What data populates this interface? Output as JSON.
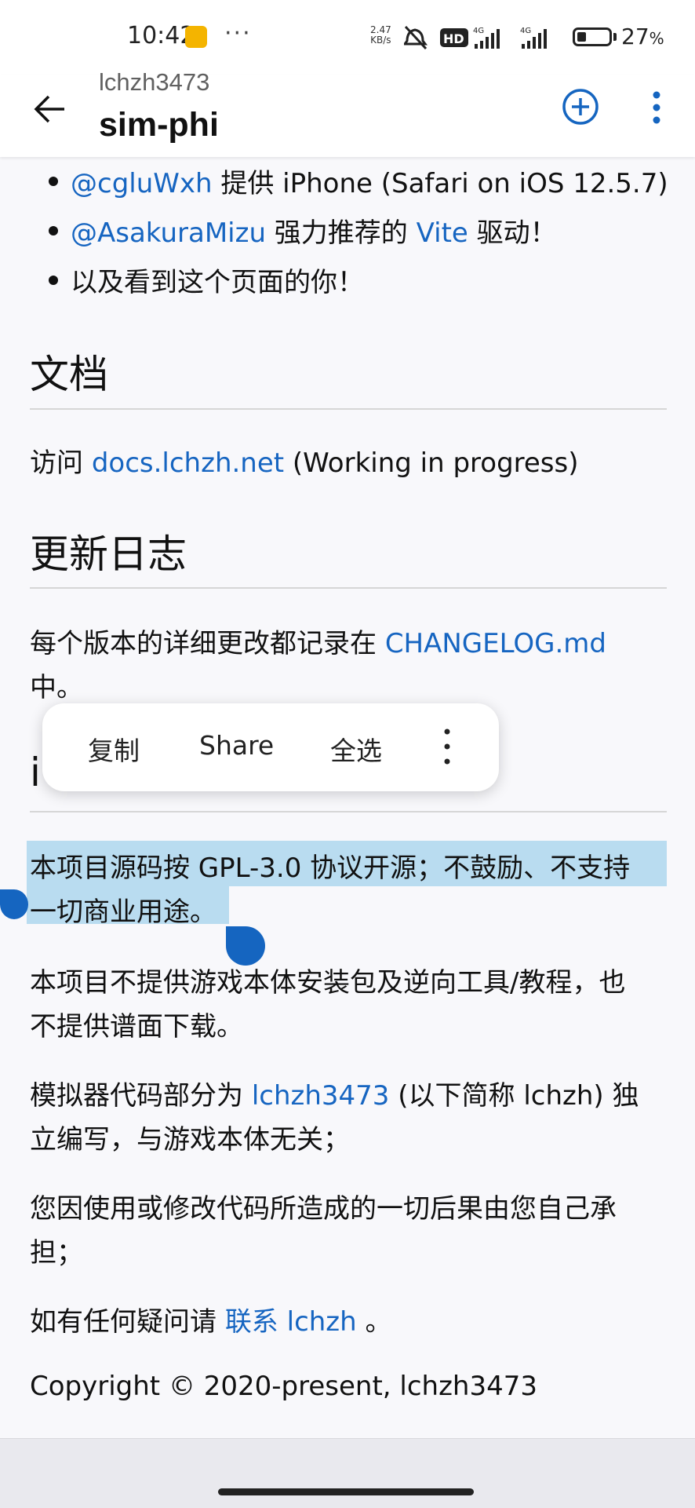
{
  "status_bar": {
    "time": "10:42",
    "dots": "···",
    "net_speed_value": "2.47",
    "net_speed_unit": "KB/s",
    "hd_label": "HD",
    "signal1_label": "4G",
    "signal2_label": "4G",
    "battery_percent": "27",
    "battery_unit": "%"
  },
  "app_bar": {
    "owner": "lchzh3473",
    "repo": "sim-phi"
  },
  "credits": [
    {
      "handle": "@cgluWxh",
      "rest": " 提供 iPhone (Safari on iOS 12.5.7)"
    },
    {
      "handle": "@AsakuraMizu",
      "mid": " 强力推荐的 ",
      "link2": "Vite",
      "rest": " 驱动！"
    },
    {
      "text": "以及看到这个页面的你！"
    }
  ],
  "docs": {
    "heading": "文档",
    "prefix": "访问 ",
    "link": "docs.lchzh.net",
    "suffix": " (Working in progress)"
  },
  "changelog": {
    "heading": "更新日志",
    "prefix": "每个版本的详细更改都记录在 ",
    "link": "CHANGELOG.md",
    "suffix": "中。"
  },
  "license": {
    "heading_partial": "i",
    "p1": "本项目源码按 GPL-3.0 协议开源；不鼓励、不支持一切商业用途。",
    "p1_line1": "本项目源码按 GPL-3.0 协议开源；不鼓励、不支持",
    "p1_line2": "一切商业用途。",
    "p2_line1": "本项目不提供游戏本体安装包及逆向工具/教程，也",
    "p2_line2": "不提供谱面下载。",
    "p3_prefix": "模拟器代码部分为 ",
    "p3_link": "lchzh3473",
    "p3_mid": " (以下简称 lchzh) 独",
    "p3_line2": "立编写，与游戏本体无关；",
    "p4_line1": "您因使用或修改代码所造成的一切后果由您自己承",
    "p4_line2": "担；",
    "p5_prefix": "如有任何疑问请 ",
    "p5_link": "联系 lchzh",
    "p5_suffix": " 。",
    "copyright": "Copyright © 2020-present, lchzh3473"
  },
  "selection_menu": {
    "copy": "复制",
    "share": "Share",
    "select_all": "全选"
  },
  "colors": {
    "link": "#1665c1",
    "selection": "#b9dcf0",
    "handle": "#1565c0"
  }
}
